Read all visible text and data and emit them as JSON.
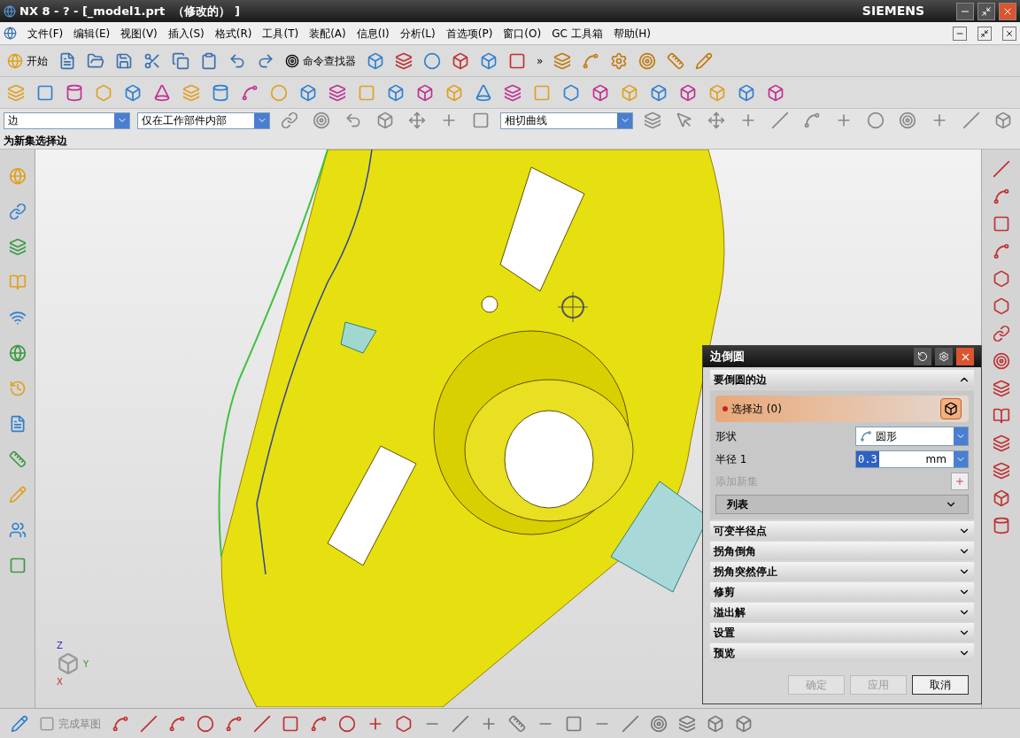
{
  "window": {
    "title": "NX 8 - ? - [_model1.prt  （修改的） ]",
    "brand": "SIEMENS"
  },
  "menu": [
    "文件(F)",
    "编辑(E)",
    "视图(V)",
    "插入(S)",
    "格式(R)",
    "工具(T)",
    "装配(A)",
    "信息(I)",
    "分析(L)",
    "首选项(P)",
    "窗口(O)",
    "GC 工具箱",
    "帮助(H)"
  ],
  "toolbar": {
    "start": "开始",
    "command_finder": "命令查找器",
    "overflow": "»"
  },
  "selection_bar": {
    "type_filter": "边",
    "scope": "仅在工作部件内部",
    "curve_rule": "相切曲线"
  },
  "cue_line": "为新集选择边",
  "dialog": {
    "title": "边倒圆",
    "group": {
      "title": "要倒圆的边",
      "expanded": true,
      "select_label": "选择边 (0)",
      "required": true,
      "shape_label": "形状",
      "shape_value": "圆形",
      "radius_label": "半径 1",
      "radius_value": "0.3",
      "radius_unit": "mm",
      "add_set": "添加新集",
      "add_set_disabled": true,
      "list_label": "列表"
    },
    "sections": [
      {
        "title": "可变半径点",
        "expanded": false
      },
      {
        "title": "拐角倒角",
        "expanded": false
      },
      {
        "title": "拐角突然停止",
        "expanded": false
      },
      {
        "title": "修剪",
        "expanded": false
      },
      {
        "title": "溢出解",
        "expanded": false
      },
      {
        "title": "设置",
        "expanded": false
      },
      {
        "title": "预览",
        "expanded": false
      }
    ],
    "buttons": [
      {
        "label": "确定",
        "disabled": true
      },
      {
        "label": "应用",
        "disabled": true
      },
      {
        "label": "取消",
        "disabled": false
      }
    ]
  },
  "sketch_toolbar": {
    "finish": "完成草图",
    "finish_disabled": true
  },
  "triad": {
    "z": "Z",
    "y": "Y",
    "x": "X"
  }
}
